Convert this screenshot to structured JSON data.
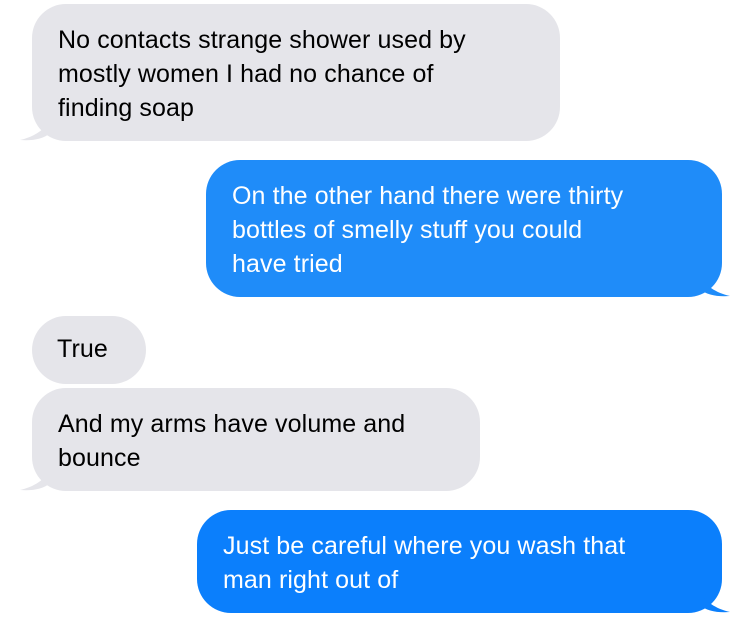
{
  "conversation": {
    "messages": [
      {
        "direction": "received",
        "text": "No contacts strange shower used by\nmostly women I had no chance of\nfinding soap"
      },
      {
        "direction": "sent",
        "text": "On the other hand there were thirty\nbottles of smelly stuff you could\nhave tried"
      },
      {
        "direction": "received",
        "text": "True"
      },
      {
        "direction": "received",
        "text": "And my arms have volume and\nbounce"
      },
      {
        "direction": "sent",
        "text": "Just be careful where you wash that\nman right out of"
      }
    ]
  },
  "colors": {
    "received_bubble": "#e5e5ea",
    "sent_bubble_top": "#1f8cf9",
    "sent_bubble_bottom": "#0b7ffc",
    "received_text": "#000000",
    "sent_text": "#ffffff"
  }
}
